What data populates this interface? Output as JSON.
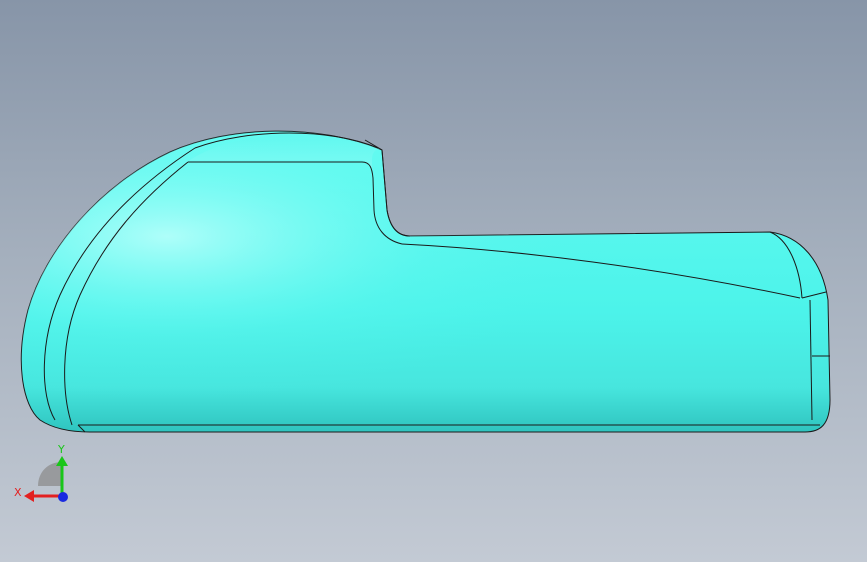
{
  "viewport": {
    "background_top": "#8795a8",
    "background_bottom": "#c3cad4",
    "model_color": "#4ef2ea",
    "edge_color": "#1a1a1a"
  },
  "triad": {
    "x_label": "X",
    "y_label": "Y",
    "x_color": "#e32020",
    "y_color": "#19c619",
    "z_color": "#1a2ae0"
  }
}
